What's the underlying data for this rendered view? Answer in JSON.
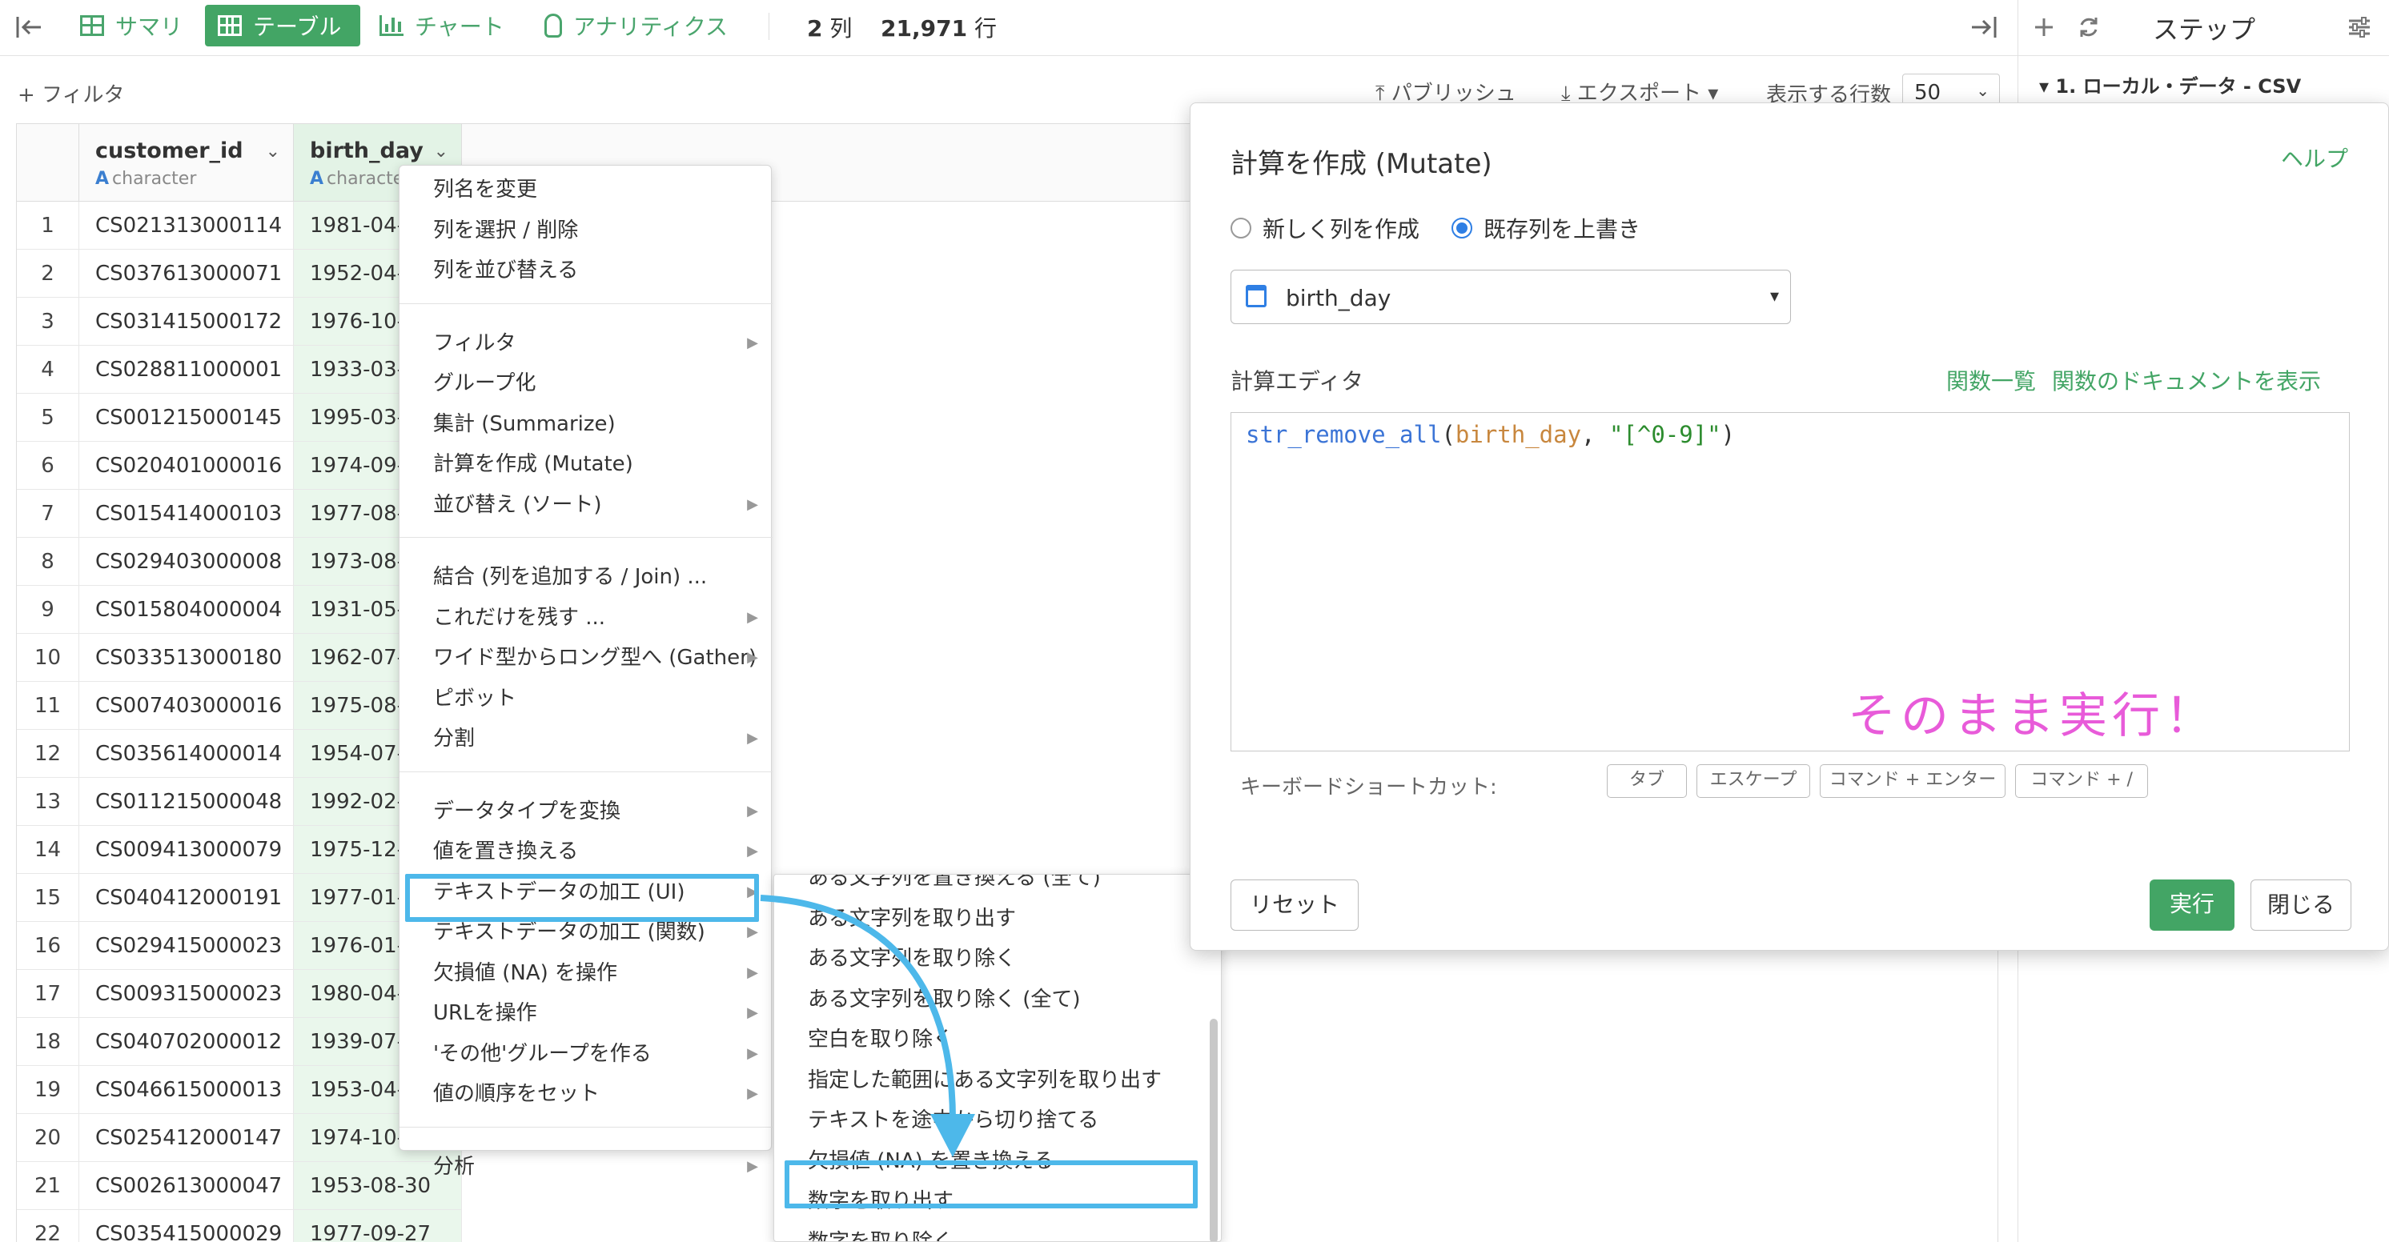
{
  "toolbar": {
    "tabs": [
      {
        "label": "サマリ"
      },
      {
        "label": "テーブル"
      },
      {
        "label": "チャート"
      },
      {
        "label": "アナリティクス"
      }
    ],
    "columns_count": "2",
    "columns_unit": "列",
    "rows_count": "21,971",
    "rows_unit": "行"
  },
  "subbar": {
    "filter": "+ フィルタ",
    "publish": "⤒ パブリッシュ",
    "export": "⤓ エクスポート ▾",
    "rows_label": "表示する行数",
    "rows_value": "50"
  },
  "steps": {
    "title": "ステップ",
    "item": "▾ 1. ローカル・データ - CSV"
  },
  "table": {
    "columns": [
      {
        "name": "customer_id",
        "type_letter": "A",
        "type": "character"
      },
      {
        "name": "birth_day",
        "type_letter": "A",
        "type": "characte"
      }
    ],
    "rows": [
      [
        "1",
        "CS021313000114",
        "1981-04-"
      ],
      [
        "2",
        "CS037613000071",
        "1952-04-"
      ],
      [
        "3",
        "CS031415000172",
        "1976-10-"
      ],
      [
        "4",
        "CS028811000001",
        "1933-03-"
      ],
      [
        "5",
        "CS001215000145",
        "1995-03-"
      ],
      [
        "6",
        "CS020401000016",
        "1974-09-"
      ],
      [
        "7",
        "CS015414000103",
        "1977-08-"
      ],
      [
        "8",
        "CS029403000008",
        "1973-08-"
      ],
      [
        "9",
        "CS015804000004",
        "1931-05-"
      ],
      [
        "10",
        "CS033513000180",
        "1962-07-"
      ],
      [
        "11",
        "CS007403000016",
        "1975-08-"
      ],
      [
        "12",
        "CS035614000014",
        "1954-07-"
      ],
      [
        "13",
        "CS011215000048",
        "1992-02-"
      ],
      [
        "14",
        "CS009413000079",
        "1975-12-"
      ],
      [
        "15",
        "CS040412000191",
        "1977-01-"
      ],
      [
        "16",
        "CS029415000023",
        "1976-01-"
      ],
      [
        "17",
        "CS009315000023",
        "1980-04-"
      ],
      [
        "18",
        "CS040702000012",
        "1939-07-"
      ],
      [
        "19",
        "CS046615000013",
        "1953-04-"
      ],
      [
        "20",
        "CS025412000147",
        "1974-10-"
      ],
      [
        "21",
        "CS002613000047",
        "1953-08-30"
      ],
      [
        "22",
        "CS035415000029",
        "1977-09-27"
      ]
    ]
  },
  "context_menu": {
    "items": [
      "列名を変更",
      "列を選択 / 削除",
      "列を並び替える",
      "フィルタ",
      "グループ化",
      "集計 (Summarize)",
      "計算を作成 (Mutate)",
      "並び替え (ソート)",
      "結合 (列を追加する / Join) ...",
      "これだけを残す ...",
      "ワイド型からロング型へ (Gather)",
      "ピボット",
      "分割",
      "データタイプを変換",
      "値を置き換える",
      "テキストデータの加工 (UI)",
      "テキストデータの加工 (関数)",
      "欠損値 (NA) を操作",
      "URLを操作",
      "'その他'グループを作る",
      "値の順序をセット",
      "分析"
    ]
  },
  "sub_menu": {
    "items": [
      "ある文字列を置き換える (全て)",
      "ある文字列を取り出す",
      "ある文字列を取り除く",
      "ある文字列を取り除く (全て)",
      "空白を取り除く",
      "指定した範囲にある文字列を取り出す",
      "テキストを途中から切り捨てる",
      "欠損値 (NA) を置き換える",
      "数字を取り出す",
      "数字を取り除く"
    ]
  },
  "dialog": {
    "title": "計算を作成 (Mutate)",
    "help": "ヘルプ",
    "radio_new": "新しく列を作成",
    "radio_overwrite": "既存列を上書き",
    "column": "birth_day",
    "editor_label": "計算エディタ",
    "fn_list": "関数一覧",
    "fn_docs": "関数のドキュメントを表示",
    "code_fn": "str_remove_all",
    "code_open": "(",
    "code_arg": "birth_day",
    "code_sep": ", ",
    "code_str": "\"[^0-9]\"",
    "code_close": ")",
    "note": "そのまま実行！",
    "kb_label": "キーボードショートカット:",
    "kb_keys": [
      "タブ",
      "エスケープ",
      "コマンド + エンター",
      "コマンド + /"
    ],
    "reset": "リセット",
    "run": "実行",
    "close": "閉じる"
  },
  "colors": {
    "accent": "#43a565",
    "highlight": "#4db8ea",
    "note": "#e85bd9"
  }
}
